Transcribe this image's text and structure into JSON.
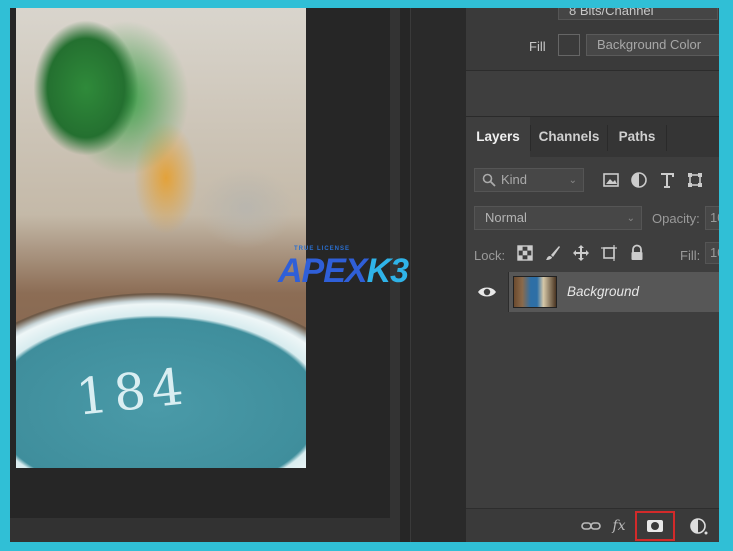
{
  "properties": {
    "bit_depth": "8 Bits/Channel",
    "fill_label": "Fill",
    "fill_value": "Background Color"
  },
  "layers_panel": {
    "tabs": [
      {
        "label": "Layers",
        "active": true
      },
      {
        "label": "Channels",
        "active": false
      },
      {
        "label": "Paths",
        "active": false
      }
    ],
    "filter_kind": "Kind",
    "filter_icons": [
      "image-filter-icon",
      "adjustment-filter-icon",
      "type-filter-icon",
      "shape-filter-icon"
    ],
    "blend_mode": "Normal",
    "opacity_label": "Opacity:",
    "opacity_value": "10",
    "lock_label": "Lock:",
    "lock_icons": [
      "lock-transparent-icon",
      "lock-paint-icon",
      "lock-move-icon",
      "lock-artboard-icon",
      "lock-all-icon"
    ],
    "fill_label": "Fill:",
    "fill_value": "10",
    "layers": [
      {
        "name": "Background",
        "visible": true
      }
    ],
    "bottom_buttons": [
      "link-layers-icon",
      "fx-icon",
      "add-mask-icon",
      "adjustment-layer-icon"
    ],
    "fx_label": "fx",
    "highlight_color": "#d22a2a"
  },
  "canvas": {
    "photo_text": "184"
  },
  "watermark": {
    "sub": "TRUE LICENSE",
    "main_a": "APEX",
    "main_b": "K3"
  }
}
